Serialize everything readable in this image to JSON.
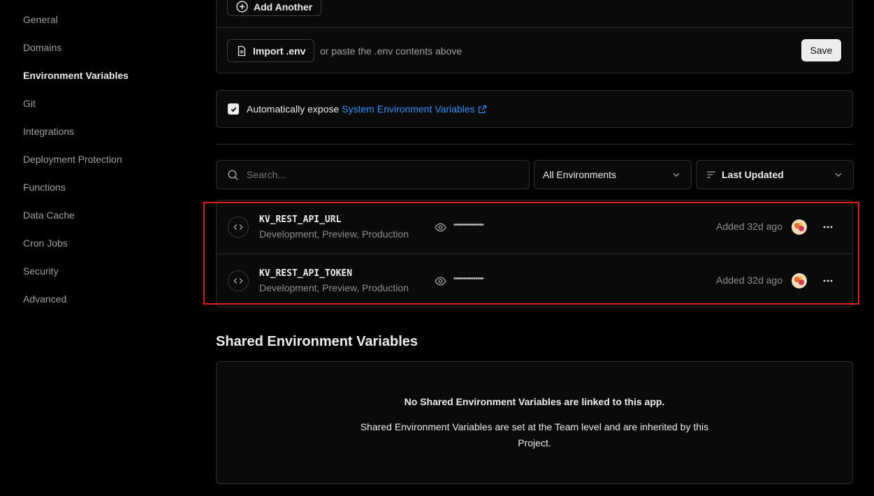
{
  "sidebar": {
    "items": [
      {
        "label": "General"
      },
      {
        "label": "Domains"
      },
      {
        "label": "Environment Variables"
      },
      {
        "label": "Git"
      },
      {
        "label": "Integrations"
      },
      {
        "label": "Deployment Protection"
      },
      {
        "label": "Functions"
      },
      {
        "label": "Data Cache"
      },
      {
        "label": "Cron Jobs"
      },
      {
        "label": "Security"
      },
      {
        "label": "Advanced"
      }
    ],
    "active_index": 2
  },
  "form": {
    "add_another_label": "Add Another",
    "import_label": "Import .env",
    "import_hint": "or paste the .env contents above",
    "save_label": "Save"
  },
  "expose": {
    "checked": true,
    "label": "Automatically expose",
    "link_label": "System Environment Variables"
  },
  "filters": {
    "search_placeholder": "Search...",
    "environment_value": "All Environments",
    "sort_value": "Last Updated"
  },
  "variables": [
    {
      "name": "KV_REST_API_URL",
      "environments": "Development, Preview, Production",
      "masked_value": "•••••••••••••••",
      "added": "Added 32d ago"
    },
    {
      "name": "KV_REST_API_TOKEN",
      "environments": "Development, Preview, Production",
      "masked_value": "•••••••••••••••",
      "added": "Added 32d ago"
    }
  ],
  "shared": {
    "title": "Shared Environment Variables",
    "empty_title": "No Shared Environment Variables are linked to this app.",
    "empty_description": "Shared Environment Variables are set at the Team level and are inherited by this Project."
  },
  "colors": {
    "background": "#000000",
    "card_border": "#2e2e2e",
    "link": "#3b8ff6",
    "highlight": "#e01e1e"
  }
}
